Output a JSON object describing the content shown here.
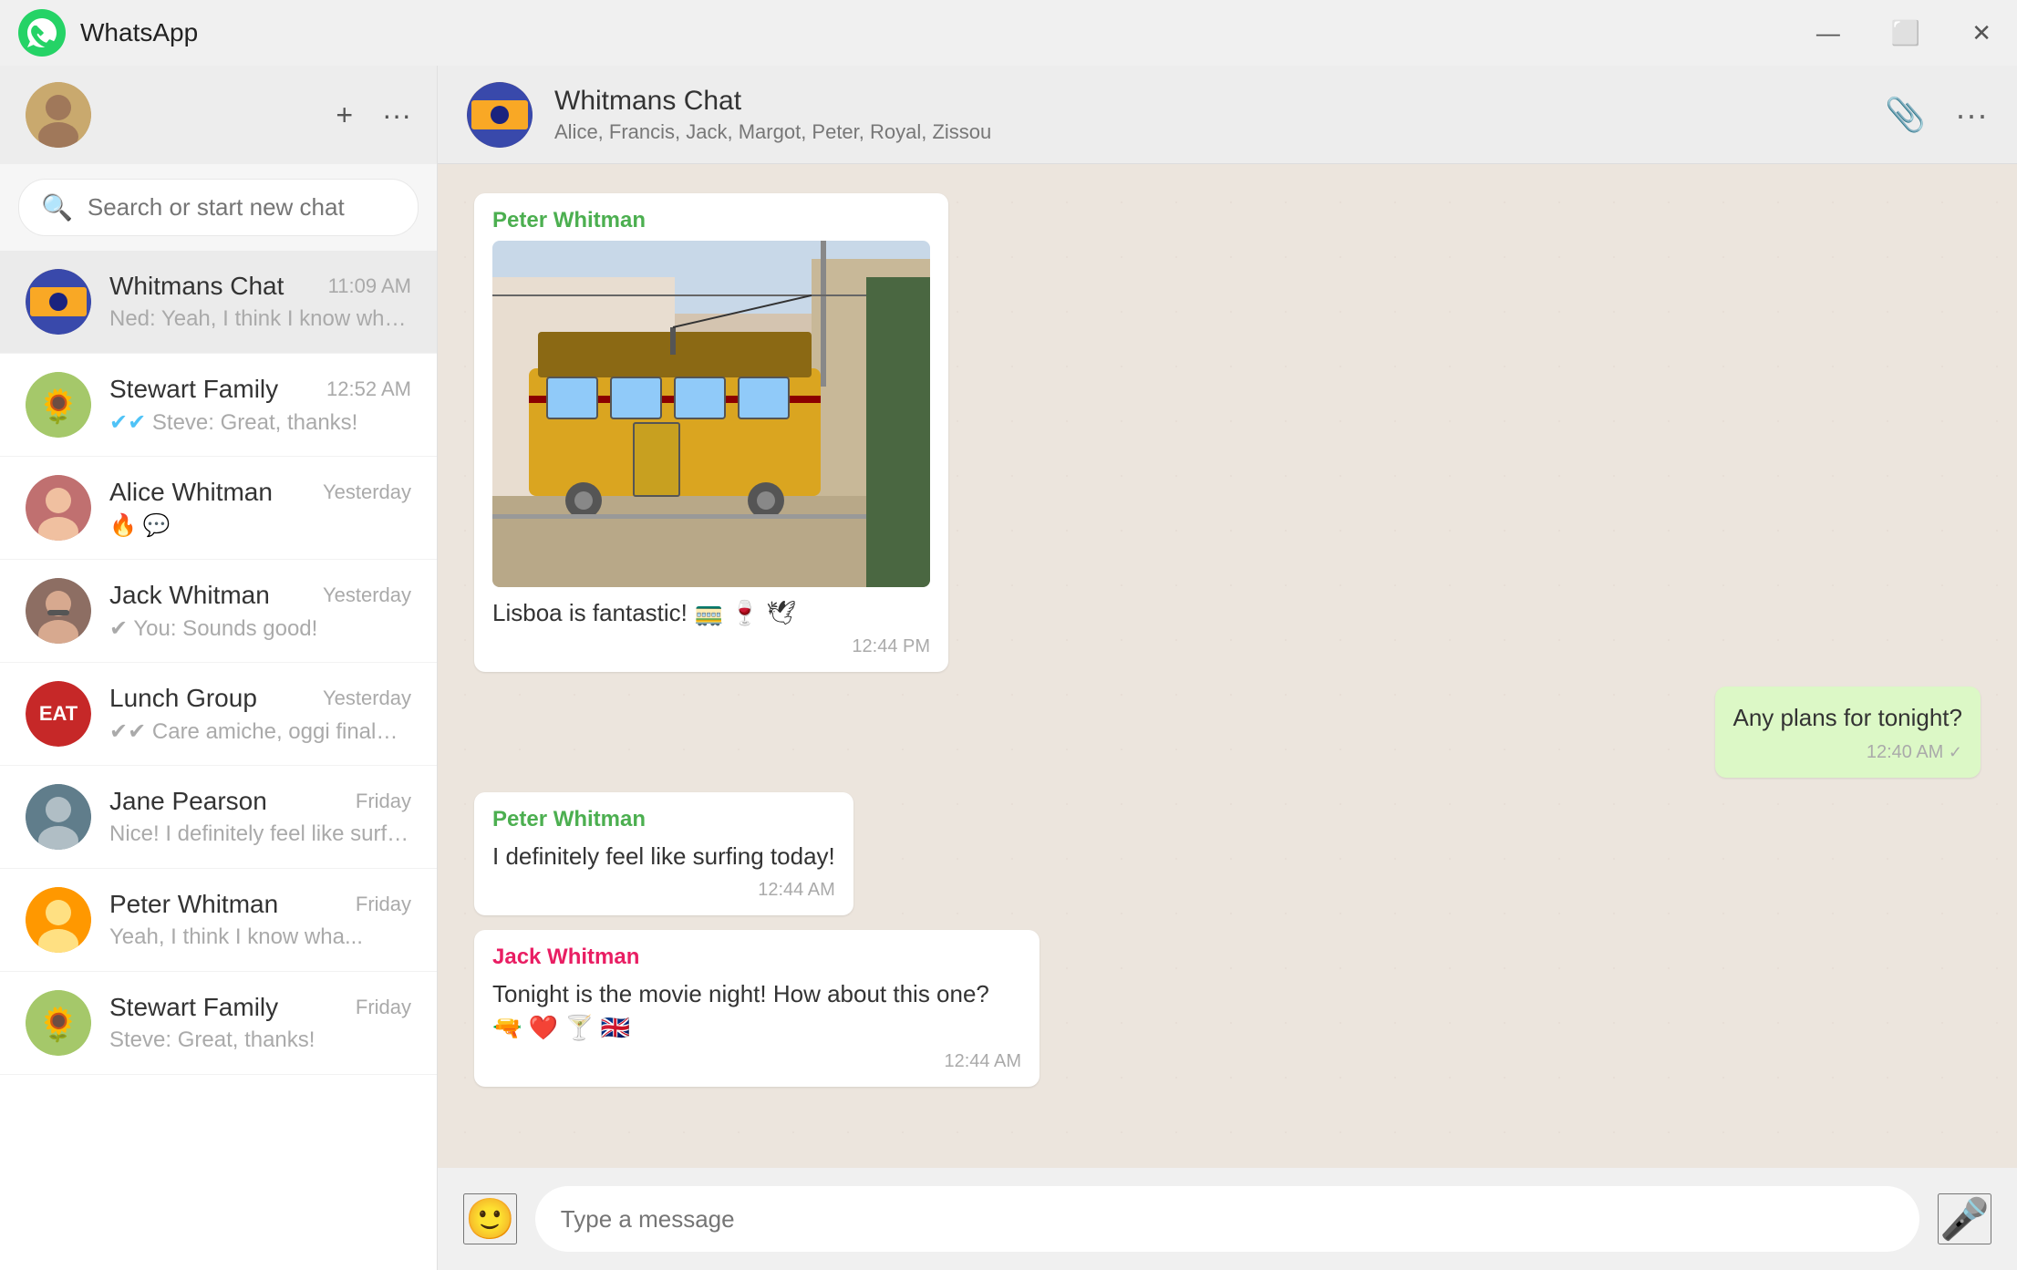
{
  "titlebar": {
    "title": "WhatsApp",
    "minimize": "—",
    "maximize": "⬜",
    "close": "✕"
  },
  "sidebar": {
    "search_placeholder": "Search or start new chat",
    "chats": [
      {
        "id": "whitmans-chat",
        "name": "Whitmans Chat",
        "time": "11:09 AM",
        "preview": "Ned: Yeah, I think I know wha...",
        "avatar_color": "#3949ab",
        "avatar_bg": "#f9a825",
        "avatar_text": "🏠",
        "active": true
      },
      {
        "id": "stewart-family",
        "name": "Stewart Family",
        "time": "12:52 AM",
        "preview": "✔✔ Steve: Great, thanks!",
        "avatar_color": "#4caf50",
        "avatar_bg": "#81c784",
        "avatar_text": "🌻",
        "active": false
      },
      {
        "id": "alice-whitman",
        "name": "Alice Whitman",
        "time": "Yesterday",
        "preview": "🔥 💬",
        "avatar_color": "#e91e63",
        "avatar_bg": "#f8bbd0",
        "avatar_text": "👩",
        "active": false
      },
      {
        "id": "jack-whitman",
        "name": "Jack Whitman",
        "time": "Yesterday",
        "preview": "✔ You: Sounds good!",
        "avatar_color": "#795548",
        "avatar_bg": "#bcaaa4",
        "avatar_text": "🧔",
        "active": false
      },
      {
        "id": "lunch-group",
        "name": "Lunch Group",
        "time": "Yesterday",
        "preview": "✔✔ Care amiche, oggi finalmente posso",
        "avatar_color": "#f44336",
        "avatar_bg": "#ef9a9a",
        "avatar_text": "EAT",
        "active": false
      },
      {
        "id": "jane-pearson",
        "name": "Jane Pearson",
        "time": "Friday",
        "preview": "Nice! I definitely feel like surfing",
        "avatar_color": "#333",
        "avatar_bg": "#bdbdbd",
        "avatar_text": "👩",
        "active": false
      },
      {
        "id": "peter-whitman",
        "name": "Peter Whitman",
        "time": "Friday",
        "preview": "Yeah, I think I know wha...",
        "avatar_color": "#ff9800",
        "avatar_bg": "#ffe082",
        "avatar_text": "👨",
        "active": false
      },
      {
        "id": "stewart-family-2",
        "name": "Stewart Family",
        "time": "Friday",
        "preview": "Steve: Great, thanks!",
        "avatar_color": "#4caf50",
        "avatar_bg": "#81c784",
        "avatar_text": "🌻",
        "active": false
      }
    ]
  },
  "chat": {
    "name": "Whitmans Chat",
    "members": "Alice, Francis, Jack, Margot, Peter, Royal, Zissou",
    "messages": [
      {
        "id": "msg1",
        "type": "incoming",
        "sender": "Peter Whitman",
        "sender_class": "peter",
        "has_image": true,
        "text": "Lisboa is fantastic! 🚃 🍷 🕊",
        "time": "12:44 PM"
      },
      {
        "id": "msg2",
        "type": "outgoing",
        "sender": "",
        "sender_class": "",
        "has_image": false,
        "text": "Any plans for tonight?",
        "time": "12:40 AM ✓"
      },
      {
        "id": "msg3",
        "type": "incoming",
        "sender": "Peter Whitman",
        "sender_class": "peter",
        "has_image": false,
        "text": "I definitely feel like surfing today!",
        "time": "12:44 AM"
      },
      {
        "id": "msg4",
        "type": "incoming",
        "sender": "Jack Whitman",
        "sender_class": "jack",
        "has_image": false,
        "text": "Tonight is the movie night! How about this one? 🔫 ❤️ 🍸 🇬🇧",
        "time": "12:44 AM"
      }
    ],
    "input_placeholder": "Type a message"
  }
}
